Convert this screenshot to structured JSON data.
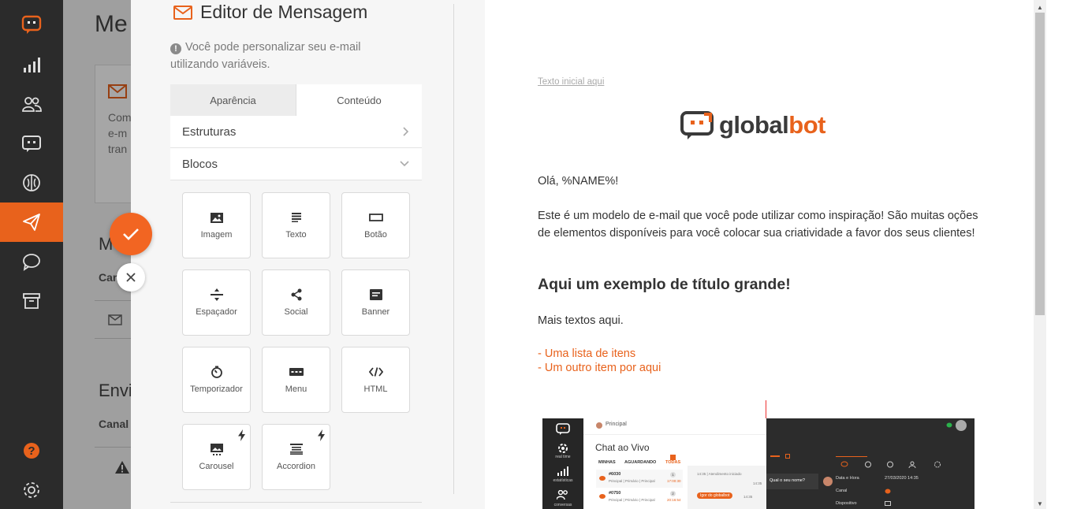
{
  "background_page": {
    "title_partial": "Me",
    "text_lines": [
      "Com",
      "e-m",
      "tran"
    ],
    "section_partial": "M",
    "label_canal": "Can",
    "send_section": "Envi",
    "label_canal2": "Canal"
  },
  "editor": {
    "title": "Editor de Mensagem",
    "hint": "Você pode personalizar seu e-mail utilizando variáveis.",
    "tabs": [
      {
        "label": "Aparência",
        "active": false
      },
      {
        "label": "Conteúdo",
        "active": true
      }
    ],
    "sections": [
      {
        "label": "Estruturas",
        "icon": "chevron-right-icon"
      },
      {
        "label": "Blocos",
        "icon": "chevron-down-icon"
      }
    ],
    "blocks": [
      {
        "label": "Imagem",
        "icon": "image-icon"
      },
      {
        "label": "Texto",
        "icon": "text-icon"
      },
      {
        "label": "Botão",
        "icon": "button-icon"
      },
      {
        "label": "Espaçador",
        "icon": "spacer-icon"
      },
      {
        "label": "Social",
        "icon": "share-icon"
      },
      {
        "label": "Banner",
        "icon": "banner-icon"
      },
      {
        "label": "Temporizador",
        "icon": "timer-icon"
      },
      {
        "label": "Menu",
        "icon": "menu-icon"
      },
      {
        "label": "HTML",
        "icon": "code-icon"
      },
      {
        "label": "Carousel",
        "icon": "carousel-icon",
        "premium": true
      },
      {
        "label": "Accordion",
        "icon": "accordion-icon",
        "premium": true
      }
    ]
  },
  "email": {
    "preheader": "Texto inicial aqui",
    "logo": {
      "part1": "global",
      "part2": "bot"
    },
    "greeting": "Olá, %NAME%!",
    "intro": "Este é um modelo de e-mail que você pode utilizar como inspiração! São muitas oções de elementos disponíveis para você colocar sua criatividade a favor dos seus clientes!",
    "heading": "Aqui um exemplo de título grande!",
    "more": "Mais textos aqui.",
    "list": [
      "- Uma lista de itens",
      "- Um outro item por aqui"
    ],
    "screenshot": {
      "breadcrumb": "Principal",
      "title": "Chat ao Vivo",
      "tabs": [
        "MINHAS",
        "AGUARDANDO",
        "TODAS"
      ],
      "nav_labels": [
        "real time",
        "estatísticas",
        "conversas"
      ],
      "rows": [
        {
          "id": "#6030",
          "meta": "Principal | Primário | Principal",
          "time": "17:00:30",
          "count": "1"
        },
        {
          "id": "#0750",
          "meta": "Principal | Primário | Principal",
          "time": "20:16:54",
          "count": "2"
        }
      ],
      "chat_system": "14:35 | Atendimento iniciado",
      "chat_bubble": "Igor do globalbot",
      "chat_time1": "14:35",
      "chat_time2": "14:35",
      "chat_question": "Qual o seu nome?",
      "details": [
        {
          "label": "Data e Hora",
          "value": "27/03/2020 14:35"
        },
        {
          "label": "Canal",
          "value": ""
        },
        {
          "label": "Dispositivo",
          "value": ""
        }
      ]
    }
  },
  "colors": {
    "accent": "#e8621c",
    "nav_bg": "#2b2b2b",
    "panel_bg": "#f6f6f6"
  }
}
